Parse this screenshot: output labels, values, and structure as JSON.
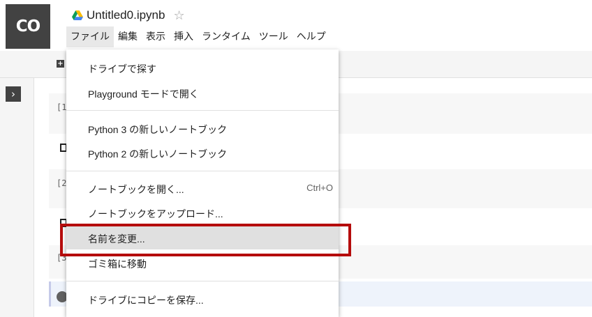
{
  "header": {
    "logo": "CO",
    "title": "Untitled0.ipynb",
    "star_icon": "star-outline-icon",
    "drive_icon": "google-drive-icon"
  },
  "menubar": {
    "items": [
      "ファイル",
      "編集",
      "表示",
      "挿入",
      "ランタイム",
      "ツール",
      "ヘルプ"
    ],
    "active_index": 0
  },
  "notebook": {
    "prompts": [
      "[1",
      "[2",
      "[3"
    ]
  },
  "file_menu": {
    "items": [
      {
        "label": "ドライブで探す",
        "shortcut": ""
      },
      {
        "label": "Playground モードで開く",
        "shortcut": ""
      },
      {
        "label": "Python 3 の新しいノートブック",
        "shortcut": ""
      },
      {
        "label": "Python 2 の新しいノートブック",
        "shortcut": ""
      },
      {
        "label": "ノートブックを開く...",
        "shortcut": "Ctrl+O"
      },
      {
        "label": "ノートブックをアップロード...",
        "shortcut": ""
      },
      {
        "label": "名前を変更...",
        "shortcut": ""
      },
      {
        "label": "ゴミ箱に移動",
        "shortcut": ""
      },
      {
        "label": "ドライブにコピーを保存...",
        "shortcut": ""
      }
    ],
    "highlighted_index": 6
  },
  "colors": {
    "annotation": "#b50c0c",
    "logo_bg": "#424242",
    "highlight": "#e0e0e0"
  }
}
